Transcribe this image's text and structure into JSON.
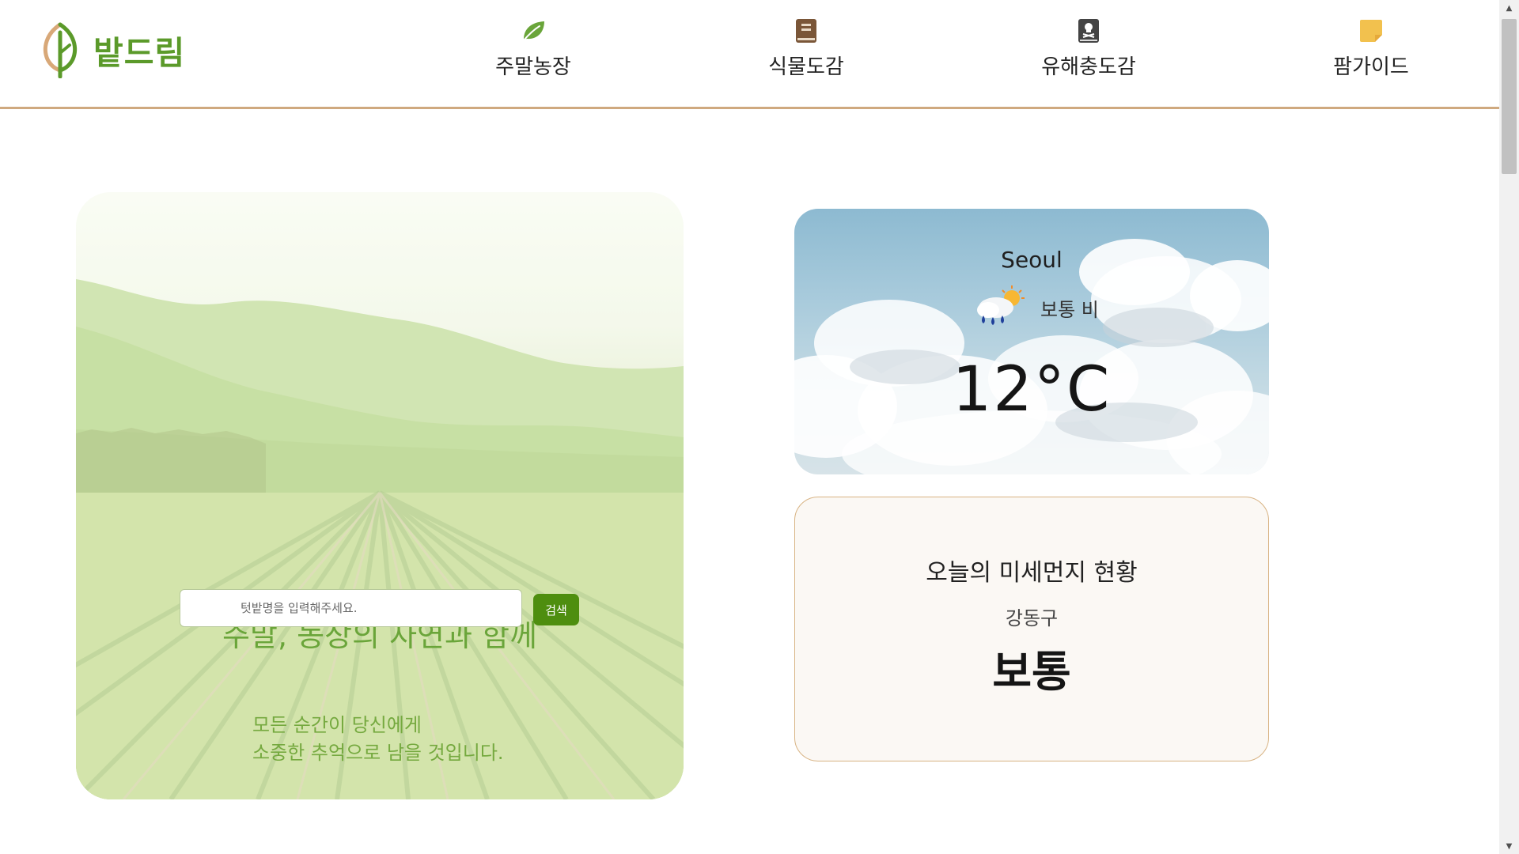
{
  "brand": {
    "name": "밭드림",
    "color": "#5b9a2a",
    "logo_icon": "leaf-icon"
  },
  "nav": {
    "items": [
      {
        "label": "주말농장",
        "icon": "sprout-icon",
        "icon_color": "#6aa53a"
      },
      {
        "label": "식물도감",
        "icon": "book-icon",
        "icon_color": "#7a5638"
      },
      {
        "label": "유해충도감",
        "icon": "skull-book-icon",
        "icon_color": "#444444"
      },
      {
        "label": "팜가이드",
        "icon": "sticky-note-icon",
        "icon_color": "#f2c14e"
      }
    ]
  },
  "hero": {
    "title": "주말, 농장의 자연과 함께",
    "line1": "모든 순간이 당신에게",
    "line2": "소중한 추억으로 남을 것입니다.",
    "search": {
      "placeholder": "텃밭명을 입력해주세요.",
      "value": "",
      "button_label": "검색"
    }
  },
  "weather": {
    "city": "Seoul",
    "condition": "보통 비",
    "condition_icon": "rain-cloud-sun-icon",
    "temperature": "12°C"
  },
  "dust": {
    "title": "오늘의 미세먼지 현황",
    "region": "강동구",
    "status": "보통"
  },
  "colors": {
    "accent_green": "#4e8e0f",
    "header_border": "#cfa97f",
    "dust_border": "#d8b383"
  }
}
